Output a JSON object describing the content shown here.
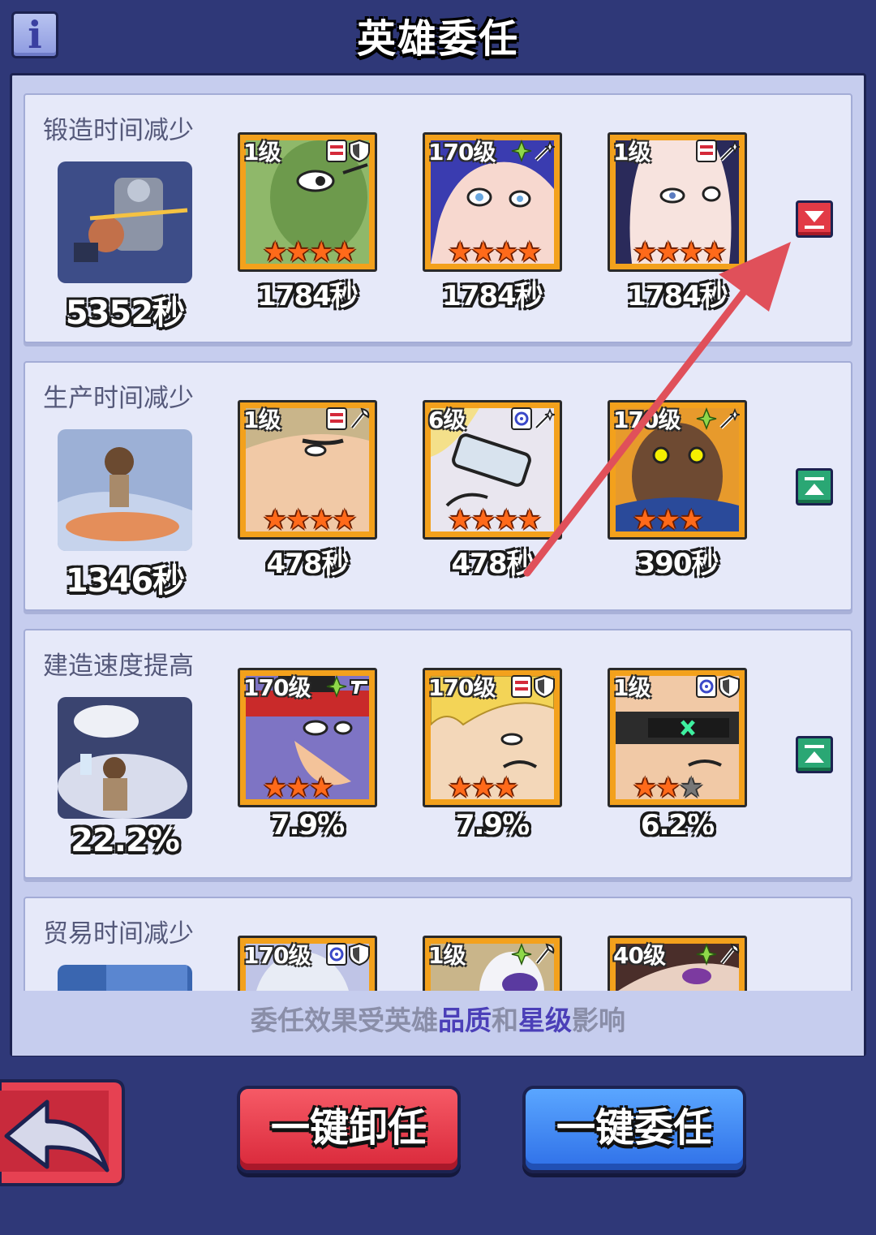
{
  "header": {
    "title": "英雄委任",
    "info_icon": "info-icon"
  },
  "rows": [
    {
      "title": "锻造时间减少",
      "total": "5352秒",
      "toggle": "down",
      "heroes": [
        {
          "level": "1级",
          "value": "1784秒",
          "stars": 4,
          "icons": [
            "rank-flag-icon",
            "shield-icon"
          ]
        },
        {
          "level": "170级",
          "value": "1784秒",
          "stars": 4,
          "icons": [
            "leaf-icon",
            "wand-icon"
          ]
        },
        {
          "level": "1级",
          "value": "1784秒",
          "stars": 4,
          "icons": [
            "rank-flag-icon",
            "wand-icon"
          ]
        }
      ]
    },
    {
      "title": "生产时间减少",
      "total": "1346秒",
      "toggle": "up",
      "heroes": [
        {
          "level": "1级",
          "value": "478秒",
          "stars": 4,
          "icons": [
            "rank-flag-icon",
            "axe-icon"
          ]
        },
        {
          "level": "6级",
          "value": "478秒",
          "stars": 4,
          "icons": [
            "circle-rank-icon",
            "wand-icon"
          ]
        },
        {
          "level": "170级",
          "value": "390秒",
          "stars": 3,
          "icons": [
            "leaf-icon",
            "wand-icon"
          ]
        }
      ]
    },
    {
      "title": "建造速度提高",
      "total": "22.2%",
      "toggle": "up",
      "heroes": [
        {
          "level": "170级",
          "value": "7.9%",
          "stars": 3,
          "icons": [
            "leaf-icon",
            "gun-icon"
          ]
        },
        {
          "level": "170级",
          "value": "7.9%",
          "stars": 3,
          "icons": [
            "rank-flag-icon",
            "shield-icon"
          ]
        },
        {
          "level": "1级",
          "value": "6.2%",
          "stars": 2.5,
          "icons": [
            "circle-rank-icon",
            "shield-icon"
          ]
        }
      ]
    },
    {
      "title": "贸易时间减少",
      "total": "",
      "toggle": "",
      "heroes": [
        {
          "level": "170级",
          "value": "",
          "stars": 0,
          "icons": [
            "circle-rank-icon",
            "shield-icon"
          ]
        },
        {
          "level": "1级",
          "value": "",
          "stars": 0,
          "icons": [
            "leaf-icon",
            "axe-icon"
          ]
        },
        {
          "level": "40级",
          "value": "",
          "stars": 0,
          "icons": [
            "leaf-icon",
            "axe-icon"
          ]
        }
      ]
    }
  ],
  "footer_note": {
    "prefix": "委任效果受英雄",
    "quality": "品质",
    "and": "和",
    "stars": "星级",
    "suffix": "影响"
  },
  "buttons": {
    "unassign": "一键卸任",
    "assign": "一键委任",
    "back_icon": "back-arrow-icon"
  },
  "colors": {
    "background": "#2f3878",
    "panel": "#c6cdee",
    "card_border": "#f3a11c",
    "star": "#ff6a1a",
    "annotation_arrow": "#e0505a"
  }
}
